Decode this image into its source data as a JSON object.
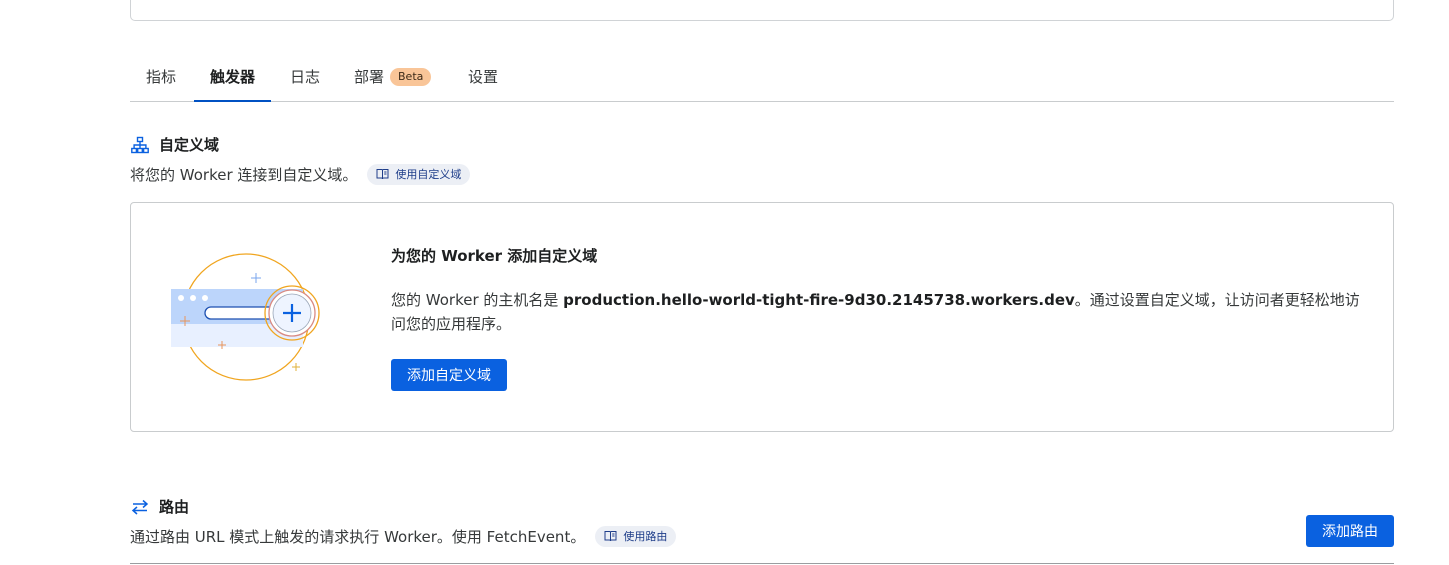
{
  "tabs": [
    {
      "label": "指标",
      "active": false
    },
    {
      "label": "触发器",
      "active": true
    },
    {
      "label": "日志",
      "active": false
    },
    {
      "label": "部署",
      "active": false,
      "badge": "Beta"
    },
    {
      "label": "设置",
      "active": false
    }
  ],
  "custom_domain": {
    "title": "自定义域",
    "description": "将您的 Worker 连接到自定义域。",
    "doc_link": "使用自定义域",
    "card": {
      "heading": "为您的 Worker 添加自定义域",
      "body_prefix": "您的 Worker 的主机名是 ",
      "hostname": "production.hello-world-tight-fire-9d30.2145738.workers.dev",
      "body_suffix": "。通过设置自定义域，让访问者更轻松地访问您的应用程序。",
      "button": "添加自定义域"
    }
  },
  "routes": {
    "title": "路由",
    "description": "通过路由 URL 模式上触发的请求执行 Worker。使用 FetchEvent。",
    "doc_link": "使用路由",
    "button": "添加路由"
  },
  "colors": {
    "accent": "#0a61e0",
    "tab_underline": "#0051c3",
    "beta_badge": "#f9c598",
    "illustration_orange": "#f0a51f"
  }
}
